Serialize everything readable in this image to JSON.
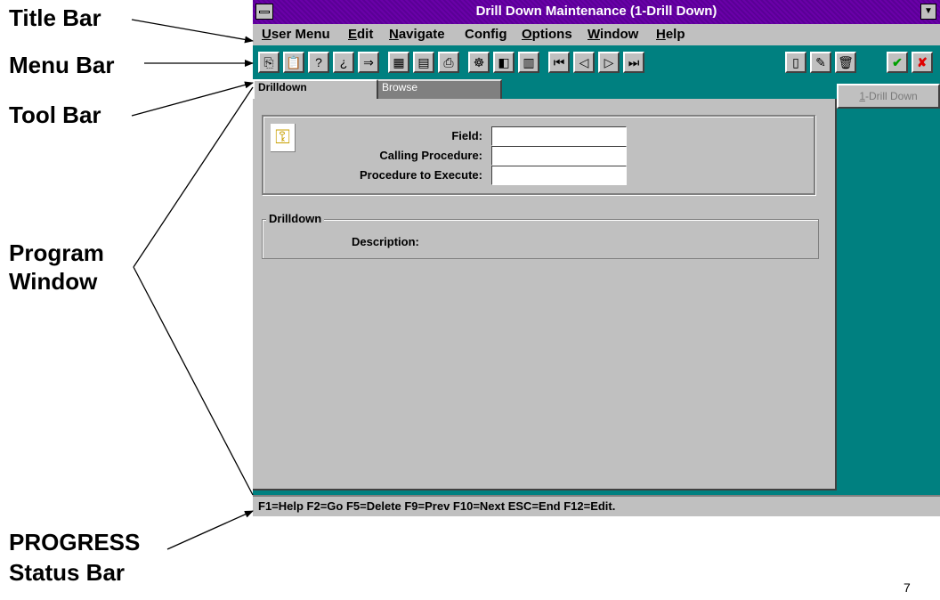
{
  "callouts": {
    "title_bar": "Title Bar",
    "menu_bar": "Menu Bar",
    "tool_bar": "Tool Bar",
    "program_window_line1": "Program",
    "program_window_line2": "Window",
    "status_bar_line1": "PROGRESS",
    "status_bar_line2": "Status Bar"
  },
  "page_number": "7",
  "window": {
    "title": "Drill Down Maintenance (1-Drill Down)",
    "title_bar_color": "#6a00a8",
    "toolbar_color": "#008080"
  },
  "menu": {
    "items": [
      {
        "accel": "U",
        "rest": "ser Menu"
      },
      {
        "accel": "E",
        "rest": "dit"
      },
      {
        "accel": "N",
        "rest": "avigate"
      },
      {
        "accel": "",
        "rest": "Config"
      },
      {
        "accel": "O",
        "rest": "ptions"
      },
      {
        "accel": "W",
        "rest": "indow"
      },
      {
        "accel": "H",
        "rest": "elp"
      }
    ]
  },
  "toolbar": {
    "icons": [
      "copy-icon",
      "paste-icon",
      "lookup-icon",
      "query-icon",
      "export-icon",
      "calculator-icon",
      "calendar-icon",
      "print-icon",
      "filter-icon",
      "chart-icon",
      "report-icon",
      "first-record-icon",
      "prev-record-icon",
      "next-record-icon",
      "last-record-icon",
      "new-record-icon",
      "edit-record-icon",
      "delete-record-icon",
      "save-check-icon",
      "cancel-x-icon"
    ]
  },
  "tabs": [
    {
      "label": "Drilldown",
      "active": true
    },
    {
      "label": "Browse",
      "active": false
    }
  ],
  "form": {
    "key_icon": "key-icon",
    "fields": [
      {
        "label": "Field:",
        "value": ""
      },
      {
        "label": "Calling Procedure:",
        "value": ""
      },
      {
        "label": "Procedure to Execute:",
        "value": ""
      }
    ],
    "group_title": "Drilldown",
    "description_label": "Description:"
  },
  "side_button": {
    "accel": "1",
    "rest": "-Drill Down"
  },
  "status": {
    "text": "F1=Help F2=Go F5=Delete F9=Prev F10=Next ESC=End F12=Edit."
  }
}
